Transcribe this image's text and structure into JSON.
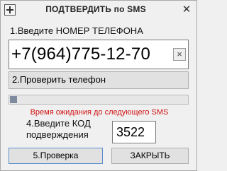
{
  "window": {
    "title": "ПОДТВЕРДИТЬ по SMS",
    "icon": "plus-icon",
    "close_label": "✕"
  },
  "phone": {
    "label": "1.Введите НОМЕР ТЕЛЕФОНА",
    "value": "+7(964)775-12-70",
    "clear_label": "×"
  },
  "check_phone_button": "2.Проверить телефон",
  "progress": {
    "fraction": 0.04
  },
  "wait_text": "Время ожидания до следующего SMS",
  "code": {
    "label_line1": "4.Введите КОД",
    "label_line2": "подверждения",
    "value": "3522"
  },
  "buttons": {
    "verify": "5.Проверка",
    "close": "ЗАКРЫТЬ"
  },
  "colors": {
    "wait_text": "#d01010",
    "progress_fill": "#7e8b9f",
    "verify_border": "#5b8ecc"
  }
}
